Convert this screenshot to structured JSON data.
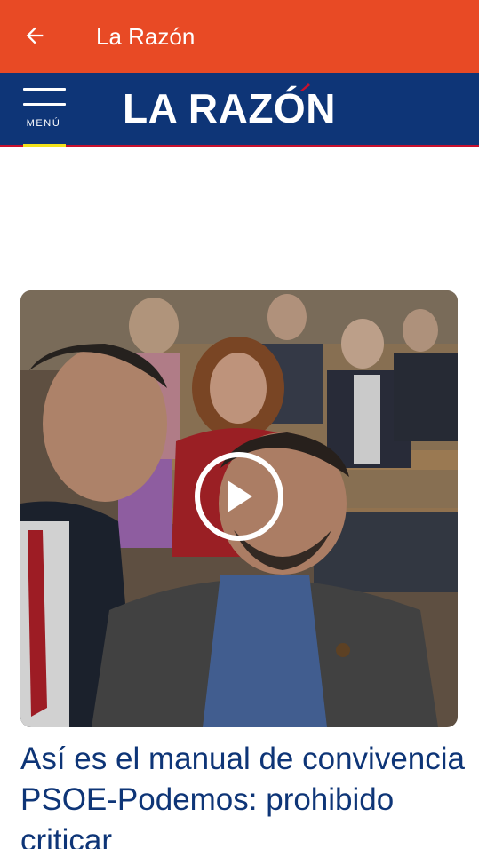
{
  "app_bar": {
    "title": "La Razón",
    "back_icon": "arrow-left-icon",
    "color": "#e84a25"
  },
  "site_header": {
    "menu_label": "MENÚ",
    "menu_icon": "hamburger-menu-icon",
    "logo_text": "LA RAZÓN",
    "background": "#0e3577",
    "accent_line": "#c8102e",
    "menu_accent": "#f2e21b"
  },
  "article": {
    "headline": "Así es el manual de convivencia PSOE-Podemos: prohibido criticar",
    "media_type": "video",
    "play_icon": "play-icon",
    "headline_color": "#0e3577"
  }
}
